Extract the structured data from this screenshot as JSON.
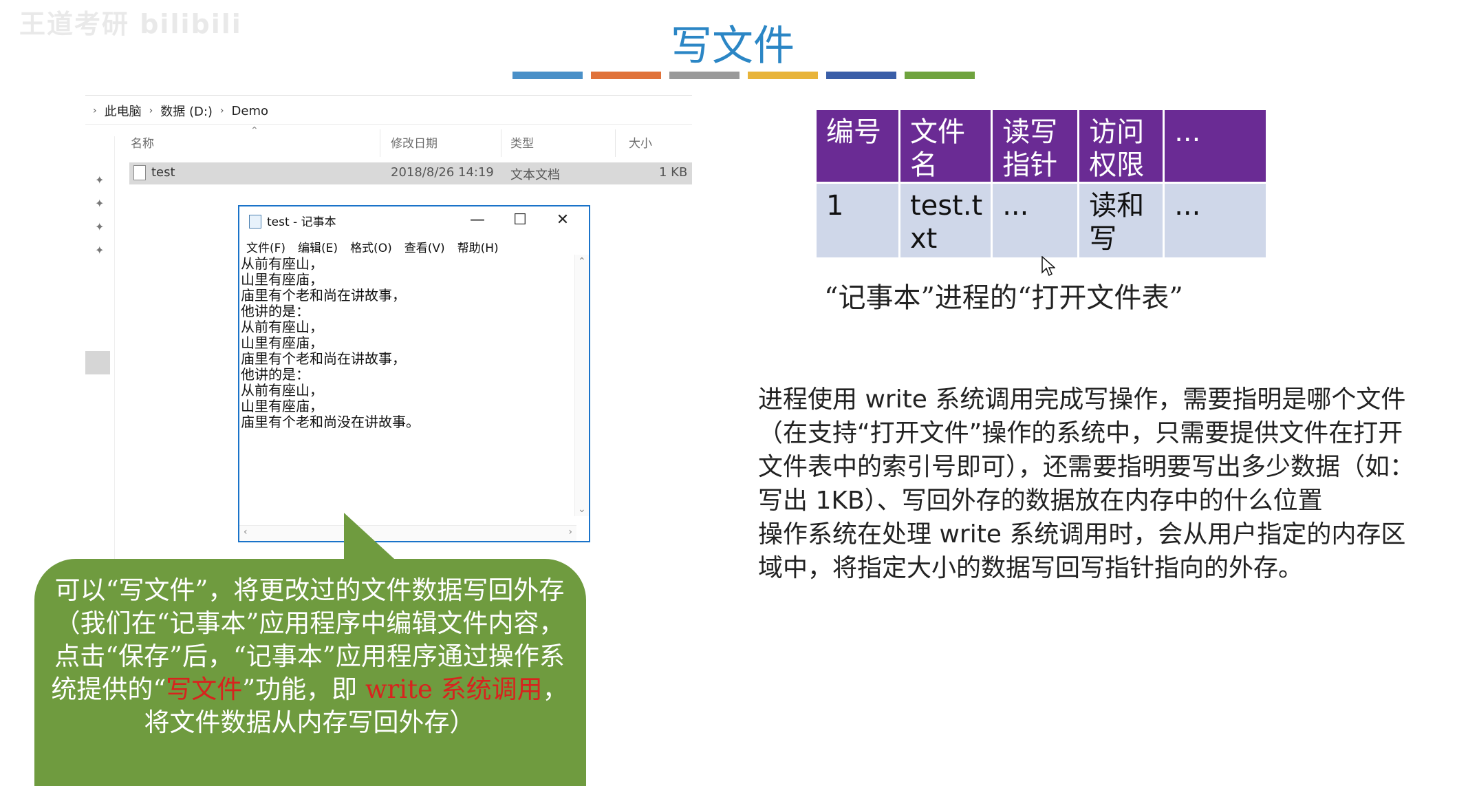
{
  "watermark": "王道考研 bilibili",
  "slide": {
    "title": "写文件",
    "bar_colors": [
      "#4a90c8",
      "#e0723a",
      "#9a9a9a",
      "#e8b43a",
      "#3a5ea8",
      "#6fa33e"
    ]
  },
  "explorer": {
    "breadcrumb": [
      "此电脑",
      "数据 (D:)",
      "Demo"
    ],
    "columns": {
      "name": "名称",
      "modified": "修改日期",
      "type": "类型",
      "size": "大小"
    },
    "file": {
      "name": "test",
      "modified": "2018/8/26 14:19",
      "type": "文本文档",
      "size": "1 KB"
    }
  },
  "notepad": {
    "title": "test - 记事本",
    "menu": [
      "文件(F)",
      "编辑(E)",
      "格式(O)",
      "查看(V)",
      "帮助(H)"
    ],
    "controls": {
      "minimize": "—",
      "maximize": "☐",
      "close": "✕"
    },
    "content": "从前有座山，\n山里有座庙，\n庙里有个老和尚在讲故事，\n他讲的是：\n从前有座山，\n山里有座庙，\n庙里有个老和尚在讲故事，\n他讲的是：\n从前有座山，\n山里有座庙，\n庙里有个老和尚没在讲故事。"
  },
  "open_file_table": {
    "headers": [
      "编号",
      "文件\n名",
      "读写\n指针",
      "访问\n权限",
      "..."
    ],
    "row": [
      "1",
      "test.t\nxt",
      "...",
      "读和\n写",
      "..."
    ],
    "caption": "“记事本”进程的“打开文件表”"
  },
  "description": {
    "p1": "进程使用 write 系统调用完成写操作，需要指明是哪个文件（在支持“打开文件”操作的系统中，只需要提供文件在打开文件表中的索引号即可），还需要指明要写出多少数据（如：写出 1KB）、写回外存的数据放在内存中的什么位置",
    "p2": "操作系统在处理 write 系统调用时，会从用户指定的内存区域中，将指定大小的数据写回写指针指向的外存。"
  },
  "bubble": {
    "part1": "可以“写文件”，将更改过的文件数据写回外存（我们在“记事本”应用程序中编辑文件内容，点击“保存”后，“记事本”应用程序通过操作系统提供的“",
    "highlight1": "写文件",
    "part2": "”功能，即 ",
    "highlight2": "write 系统调用",
    "part3": "，将文件数据从内存写回外存）"
  }
}
